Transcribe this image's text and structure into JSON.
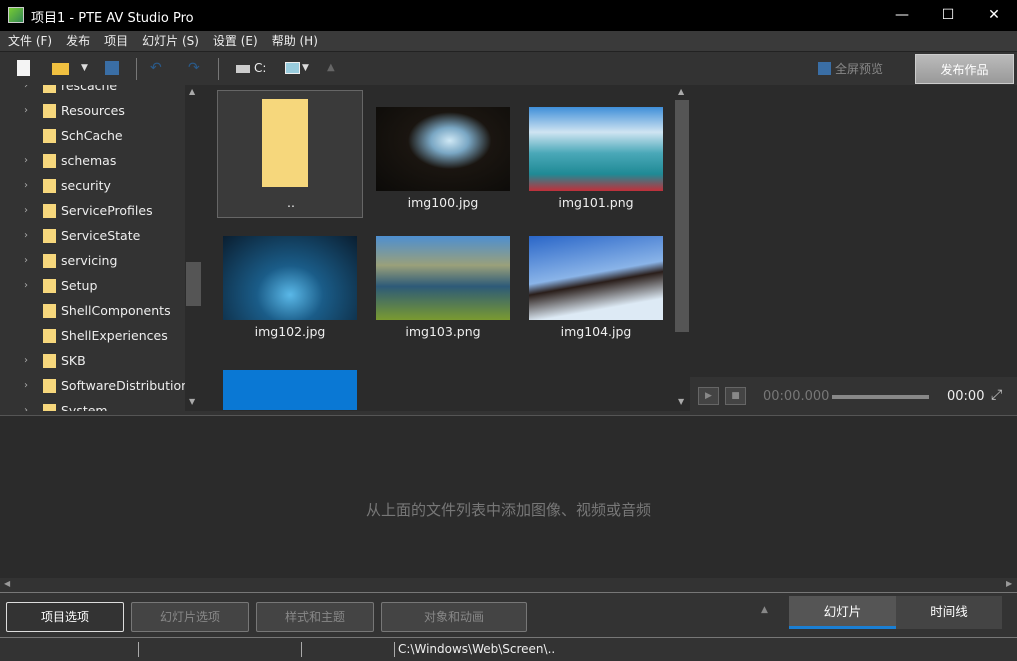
{
  "window": {
    "title": "项目1 - PTE AV Studio Pro",
    "minimize": "—",
    "maximize": "☐",
    "close": "✕"
  },
  "menu": [
    "文件 (F)",
    "发布",
    "项目",
    "幻灯片 (S)",
    "设置 (E)",
    "帮助 (H)"
  ],
  "toolbar": {
    "drive": "C:",
    "fullscreen_preview": "全屏预览",
    "publish": "发布作品"
  },
  "tree": [
    {
      "label": "rescache",
      "expandable": true
    },
    {
      "label": "Resources",
      "expandable": true
    },
    {
      "label": "SchCache",
      "expandable": false
    },
    {
      "label": "schemas",
      "expandable": true
    },
    {
      "label": "security",
      "expandable": true
    },
    {
      "label": "ServiceProfiles",
      "expandable": true
    },
    {
      "label": "ServiceState",
      "expandable": true
    },
    {
      "label": "servicing",
      "expandable": true
    },
    {
      "label": "Setup",
      "expandable": true
    },
    {
      "label": "ShellComponents",
      "expandable": false
    },
    {
      "label": "ShellExperiences",
      "expandable": false
    },
    {
      "label": "SKB",
      "expandable": true
    },
    {
      "label": "SoftwareDistribution",
      "expandable": true
    },
    {
      "label": "System",
      "expandable": true
    }
  ],
  "files": [
    {
      "name": ".."
    },
    {
      "name": "img100.jpg"
    },
    {
      "name": "img101.png"
    },
    {
      "name": "img102.jpg"
    },
    {
      "name": "img103.png"
    },
    {
      "name": "img104.jpg"
    },
    {
      "name": ""
    }
  ],
  "player": {
    "time_current": "00:00.000",
    "time_end": "00:00"
  },
  "slides": {
    "hint": "从上面的文件列表中添加图像、视频或音频"
  },
  "bottom": {
    "project_options": "项目选项",
    "slide_options": "幻灯片选项",
    "styles_themes": "样式和主题",
    "objects_animation": "对象和动画",
    "tab_slides": "幻灯片",
    "tab_timeline": "时间线"
  },
  "status": {
    "path": "C:\\Windows\\Web\\Screen\\.."
  },
  "colors": {
    "accent": "#1a7fd4",
    "folder": "#f6d77c"
  }
}
